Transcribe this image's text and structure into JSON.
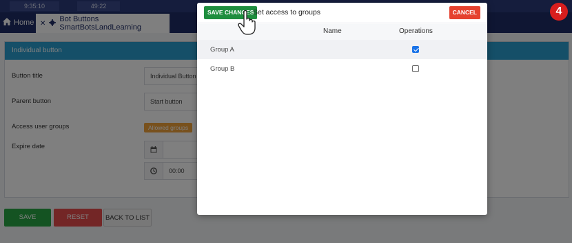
{
  "topbar": {
    "time1": "9:35:10",
    "time2": "49:22"
  },
  "tabs": {
    "home": "Home",
    "active": "Bot Buttons SmartBotsLandLearning"
  },
  "panel": {
    "header": "Individual button",
    "button_title_label": "Button title",
    "button_title_value": "Individual Button",
    "parent_button_label": "Parent button",
    "parent_button_value": "Start button",
    "access_groups_label": "Access user groups",
    "allowed_groups_badge": "Allowed groups",
    "expire_date_label": "Expire date",
    "time_value": "00:00"
  },
  "actions": {
    "save": "SAVE",
    "reset": "RESET",
    "back": "BACK TO LIST"
  },
  "step": "4",
  "modal": {
    "save_changes": "SAVE CHANGES",
    "title": "Set access to groups",
    "cancel": "CANCEL",
    "columns": {
      "name": "Name",
      "operations": "Operations"
    },
    "rows": [
      {
        "group": "Group A",
        "checked": true
      },
      {
        "group": "Group B",
        "checked": false
      }
    ]
  },
  "colors": {
    "header_blue": "#2a9fd0",
    "save_green": "#1e8e3e",
    "cancel_red": "#e5412f",
    "badge_red": "#d81e1e",
    "checkbox_blue": "#1a73e8"
  },
  "icons": [
    "home-icon",
    "close-icon",
    "calendar-icon",
    "clock-icon",
    "pointer-hand-icon"
  ]
}
